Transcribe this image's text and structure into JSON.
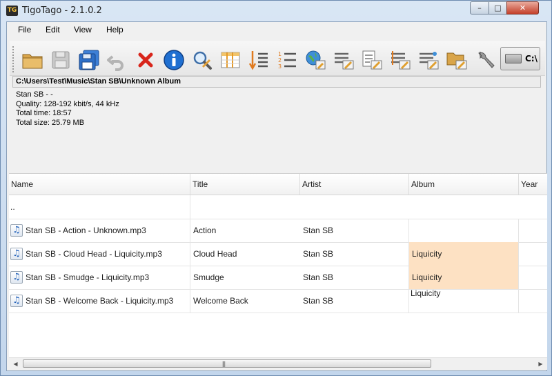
{
  "window": {
    "title": "TigoTago - 2.1.0.2",
    "icon_text": "TG",
    "controls": {
      "minimize": "–",
      "maximize": "□",
      "close": "✕"
    }
  },
  "menu": [
    "File",
    "Edit",
    "View",
    "Help"
  ],
  "toolbar": {
    "buttons": [
      {
        "name": "open-folder-icon"
      },
      {
        "name": "save-icon",
        "disabled": true
      },
      {
        "name": "save-all-icon"
      },
      {
        "name": "undo-icon",
        "disabled": true
      },
      {
        "name": "delete-icon"
      },
      {
        "name": "info-icon"
      },
      {
        "name": "search-edit-icon"
      },
      {
        "name": "columns-icon"
      },
      {
        "name": "sort-icon"
      },
      {
        "name": "numbering-icon"
      },
      {
        "name": "web-lookup-icon"
      },
      {
        "name": "batch-1-icon"
      },
      {
        "name": "batch-2-icon"
      },
      {
        "name": "batch-3-icon"
      },
      {
        "name": "batch-4-icon"
      },
      {
        "name": "folder-batch-icon"
      },
      {
        "name": "settings-wrench-icon"
      }
    ],
    "drive_label": "C:\\"
  },
  "path": "C:\\Users\\Test\\Music\\Stan SB\\Unknown Album",
  "info": {
    "artist_album": "Stan SB -  -",
    "quality": "Quality: 128-192 kbit/s, 44 kHz",
    "total_time": "Total time: 18:57",
    "total_size": "Total size: 25.79 MB"
  },
  "table": {
    "columns": [
      "Name",
      "Title",
      "Artist",
      "Album",
      "Year"
    ],
    "parent_row": "..",
    "rows": [
      {
        "name": "Stan SB - Action - Unknown.mp3",
        "title": "Action",
        "artist": "Stan SB",
        "album": "",
        "highlight": false
      },
      {
        "name": "Stan SB - Cloud Head - Liquicity.mp3",
        "title": "Cloud Head",
        "artist": "Stan SB",
        "album": "Liquicity",
        "highlight": true
      },
      {
        "name": "Stan SB - Smudge - Liquicity.mp3",
        "title": "Smudge",
        "artist": "Stan SB",
        "album": "Liquicity",
        "highlight": true
      },
      {
        "name": "Stan SB - Welcome Back - Liquicity.mp3",
        "title": "Welcome Back",
        "artist": "Stan SB",
        "album": "",
        "highlight": false
      }
    ],
    "overflow_text": "Liquicity",
    "file_icon_glyph": "♫"
  },
  "scrollbar": {
    "left_arrow": "◀",
    "right_arrow": "▶",
    "grip": "|||"
  }
}
